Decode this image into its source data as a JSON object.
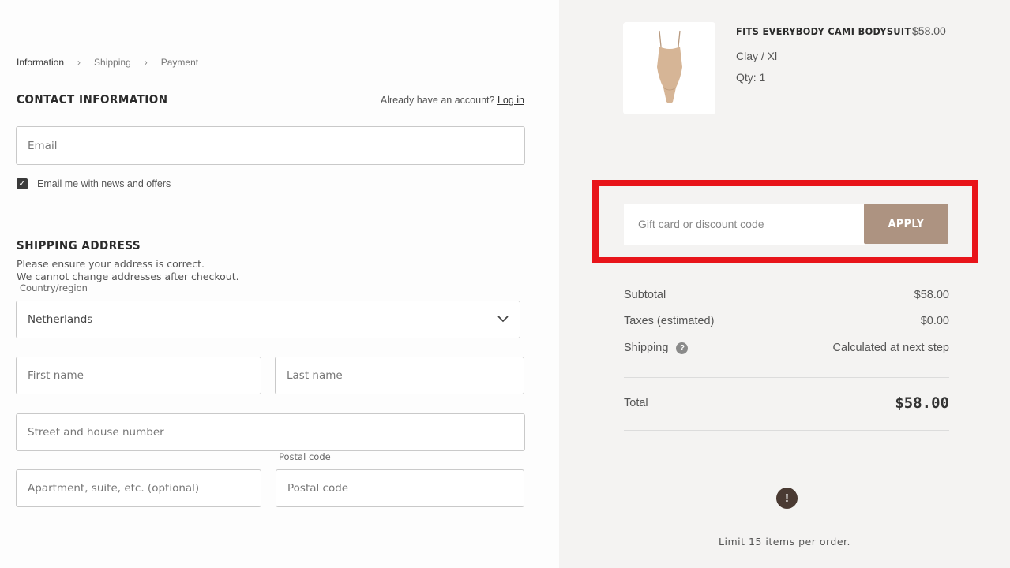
{
  "breadcrumb": {
    "items": [
      "Information",
      "Shipping",
      "Payment"
    ],
    "separator": "›"
  },
  "contact": {
    "title": "CONTACT INFORMATION",
    "account_prompt": "Already have an account?",
    "login_link": "Log in",
    "email_placeholder": "Email",
    "newsletter_label": "Email me with news and offers",
    "newsletter_checked": true
  },
  "shipping": {
    "title": "SHIPPING ADDRESS",
    "hint_line1": "Please ensure your address is correct.",
    "hint_line2": "We cannot change addresses after checkout.",
    "country_label": "Country/region",
    "country_value": "Netherlands",
    "first_name_placeholder": "First name",
    "last_name_placeholder": "Last name",
    "street_placeholder": "Street and house number",
    "postal_label": "Postal code",
    "apartment_placeholder": "Apartment, suite, etc. (optional)",
    "postal_placeholder": "Postal code"
  },
  "product": {
    "name": "FITS EVERYBODY CAMI BODYSUIT",
    "price": "$58.00",
    "variant": "Clay / Xl",
    "qty": "Qty: 1"
  },
  "discount": {
    "placeholder": "Gift card or discount code",
    "apply_label": "APPLY"
  },
  "summary": {
    "subtotal_label": "Subtotal",
    "subtotal_value": "$58.00",
    "taxes_label": "Taxes (estimated)",
    "taxes_value": "$0.00",
    "shipping_label": "Shipping",
    "shipping_value": "Calculated at next step",
    "total_label": "Total",
    "total_value": "$58.00"
  },
  "notice": {
    "limit_text": "Limit 15 items per order."
  },
  "colors": {
    "apply_button": "#ad9381",
    "highlight_border": "#e8141a",
    "sidebar_bg": "#f4f3f2"
  }
}
